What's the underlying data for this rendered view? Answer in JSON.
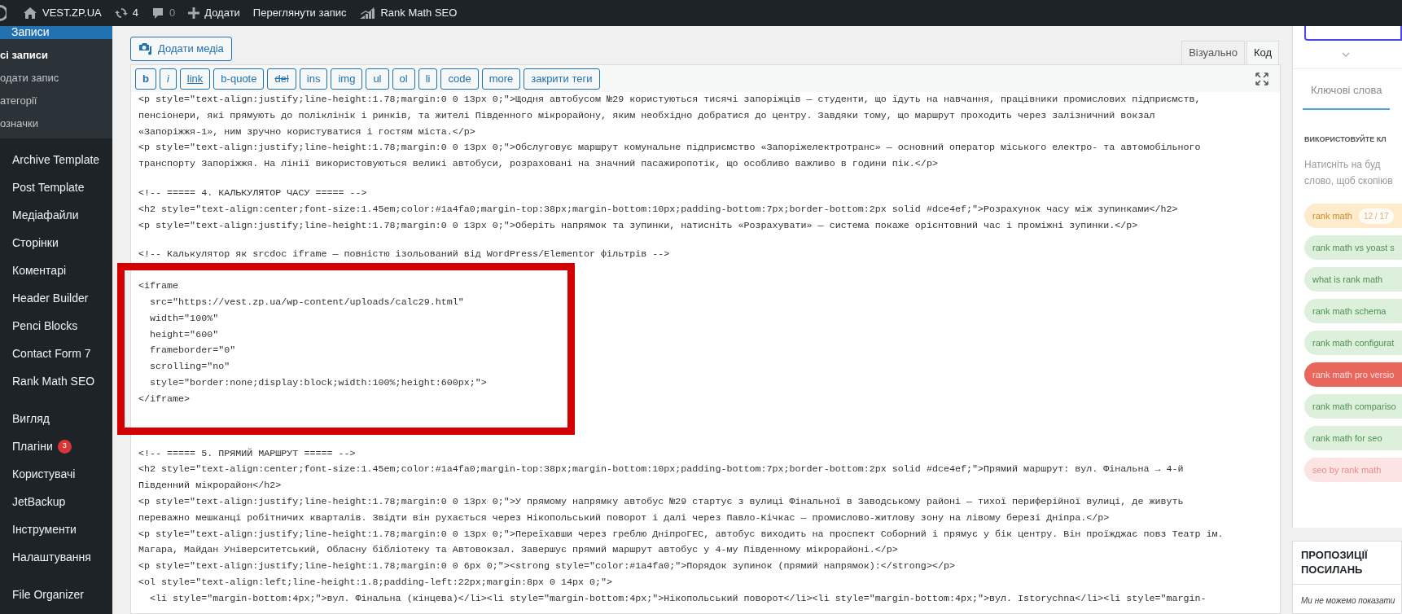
{
  "admin_bar": {
    "items": [
      {
        "kind": "home",
        "label": "VEST.ZP.UA"
      },
      {
        "kind": "updates",
        "label": "4"
      },
      {
        "kind": "comments",
        "label": "0"
      },
      {
        "kind": "new",
        "label": "Додати"
      },
      {
        "kind": "plain",
        "label": "Переглянути запис"
      },
      {
        "kind": "chart",
        "label": "Rank Math SEO"
      }
    ]
  },
  "sidebar": {
    "current": {
      "label": "Записи",
      "selected": true
    },
    "submenu": [
      {
        "label": "сі записи",
        "selected": true
      },
      {
        "label": "одати запис",
        "selected": false
      },
      {
        "label": "атегорії",
        "selected": false
      },
      {
        "label": "означки",
        "selected": false
      }
    ],
    "menu_groups": [
      [
        {
          "label": "Archive Template"
        },
        {
          "label": "Post Template"
        },
        {
          "label": "Медіафайли"
        },
        {
          "label": "Сторінки"
        },
        {
          "label": "Коментарі"
        },
        {
          "label": "Header Builder"
        },
        {
          "label": "Penci Blocks"
        },
        {
          "label": "Contact Form 7"
        },
        {
          "label": "Rank Math SEO"
        }
      ],
      [
        {
          "label": "Вигляд"
        },
        {
          "label": "Плагіни",
          "badge": "3"
        },
        {
          "label": "Користувачі"
        },
        {
          "label": "JetBackup"
        },
        {
          "label": "Інструменти"
        },
        {
          "label": "Налаштування"
        }
      ],
      [
        {
          "label": "File Organizer"
        }
      ]
    ]
  },
  "editor": {
    "add_media_button": "Додати медіа",
    "tabs": [
      {
        "label": "Візуально",
        "selected": false
      },
      {
        "label": "Код",
        "selected": true
      }
    ],
    "quicktags": [
      {
        "label": "b",
        "kind": "bold"
      },
      {
        "label": "i",
        "kind": "italic"
      },
      {
        "label": "link",
        "kind": "underline"
      },
      {
        "label": "b-quote",
        "kind": "plain"
      },
      {
        "label": "del",
        "kind": "strike"
      },
      {
        "label": "ins",
        "kind": "plain"
      },
      {
        "label": "img",
        "kind": "plain"
      },
      {
        "label": "ul",
        "kind": "plain"
      },
      {
        "label": "ol",
        "kind": "plain"
      },
      {
        "label": "li",
        "kind": "plain"
      },
      {
        "label": "code",
        "kind": "plain"
      },
      {
        "label": "more",
        "kind": "plain"
      },
      {
        "label": "закрити теги",
        "kind": "plain"
      }
    ],
    "code_blocks": [
      {
        "highlighted": false,
        "lines": [
          "<p style=\"text-align:justify;line-height:1.78;margin:0 0 13px 0;\">Щодня автобусом №29 користуються тисячі запоріжців — студенти, що їдуть на навчання, працівники промислових підприємств,",
          "пенсіонери, які прямують до поліклінік і ринків, та жителі Південного мікрорайону, яким необхідно добратися до центру. Завдяки тому, що маршрут проходить через залізничний вокзал",
          "«Запоріжжя-1», ним зручно користуватися і гостям міста.</p>",
          "<p style=\"text-align:justify;line-height:1.78;margin:0 0 13px 0;\">Обслуговує маршрут комунальне підприємство «Запоріжелектротранс» — основний оператор міського електро- та автомобільного",
          "транспорту Запоріжжя. На лінії використовуються великі автобуси, розраховані на значний пасажиропотік, що особливо важливо в години пік.</p>"
        ]
      },
      {
        "highlighted": false,
        "lines": [
          "<!-- ===== 4. КАЛЬКУЛЯТОР ЧАСУ ===== -->",
          "<h2 style=\"text-align:center;font-size:1.45em;color:#1a4fa0;margin-top:38px;margin-bottom:10px;padding-bottom:7px;border-bottom:2px solid #dce4ef;\">Розрахунок часу між зупинками</h2>",
          "<p style=\"text-align:justify;line-height:1.78;margin:0 0 13px 0;\">Оберіть напрямок та зупинки, натисніть «Розрахувати» — система покаже орієнтовний час і проміжні зупинки.</p>"
        ]
      },
      {
        "highlighted": false,
        "lines": [
          "<!-- Калькулятор як srcdoc iframe — повністю ізольований від WordPress/Elementor фільтрів -->"
        ]
      },
      {
        "highlighted": true,
        "lines": [
          "<iframe",
          "  src=\"https://vest.zp.ua/wp-content/uploads/calc29.html\"",
          "  width=\"100%\"",
          "  height=\"600\"",
          "  frameborder=\"0\"",
          "  scrolling=\"no\"",
          "  style=\"border:none;display:block;width:100%;height:600px;\">",
          "</iframe>"
        ]
      },
      {
        "highlighted": false,
        "lines": [
          "<!-- ===== 5. ПРЯМИЙ МАРШРУТ ===== -->",
          "<h2 style=\"text-align:center;font-size:1.45em;color:#1a4fa0;margin-top:38px;margin-bottom:10px;padding-bottom:7px;border-bottom:2px solid #dce4ef;\">Прямий маршрут: вул. Фінальна → 4-й",
          "Південний мікрорайон</h2>",
          "<p style=\"text-align:justify;line-height:1.78;margin:0 0 13px 0;\">У прямому напрямку автобус №29 стартує з вулиці Фінальної в Заводському районі — тихої периферійної вулиці, де живуть",
          "переважно мешканці робітничих кварталів. Звідти він рухається через Нікопольський поворот і далі через Павло-Кічкас — промислово-житлову зону на лівому березі Дніпра.</p>",
          "<p style=\"text-align:justify;line-height:1.78;margin:0 0 13px 0;\">Переїхавши через греблю ДніпроГЕС, автобус виходить на проспект Соборний і прямує у бік центру. Він проїжджає повз Театр ім.",
          "Магара, Майдан Університетський, Обласну бібліотеку та Автовокзал. Завершує прямий маршрут автобус у 4-му Південному мікрорайоні.</p>",
          "<p style=\"text-align:justify;line-height:1.78;margin:0 0 6px 0;\"><strong style=\"color:#1a4fa0;\">Порядок зупинок (прямий напрямок):</strong></p>",
          "<ol style=\"text-align:left;line-height:1.8;padding-left:22px;margin:8px 0 14px 0;\">",
          "  <li style=\"margin-bottom:4px;\">вул. Фінальна (кінцева)</li><li style=\"margin-bottom:4px;\">Нікопольський поворот</li><li style=\"margin-bottom:4px;\">вул. Istorychna</li><li style=\"margin-"
        ]
      }
    ]
  },
  "seo_panel": {
    "tabs": [
      {
        "label": "Ключові слова",
        "selected": true
      }
    ],
    "heading": "ВИКОРИСТОВУЙТЕ КЛ",
    "hint_lines": [
      "Натисніть на буд",
      "слово, щоб скопіюв"
    ],
    "keywords": [
      {
        "label": "rank math",
        "count": "12 / 17",
        "kind": "warning"
      },
      {
        "label": "rank math vs yoast s",
        "kind": "good"
      },
      {
        "label": "what is rank math",
        "kind": "good"
      },
      {
        "label": "rank math schema",
        "kind": "good"
      },
      {
        "label": "rank math configurat",
        "kind": "good"
      },
      {
        "label": "rank math pro versio",
        "kind": "bad"
      },
      {
        "label": "rank math compariso",
        "kind": "good"
      },
      {
        "label": "rank math for seo",
        "kind": "good"
      },
      {
        "label": "seo by rank math",
        "kind": "weak"
      }
    ]
  },
  "link_suggestions": {
    "title_lines": [
      "ПРОПОЗИЦІЇ",
      "ПОСИЛАНЬ"
    ],
    "note": "Ми не можемо показати"
  }
}
